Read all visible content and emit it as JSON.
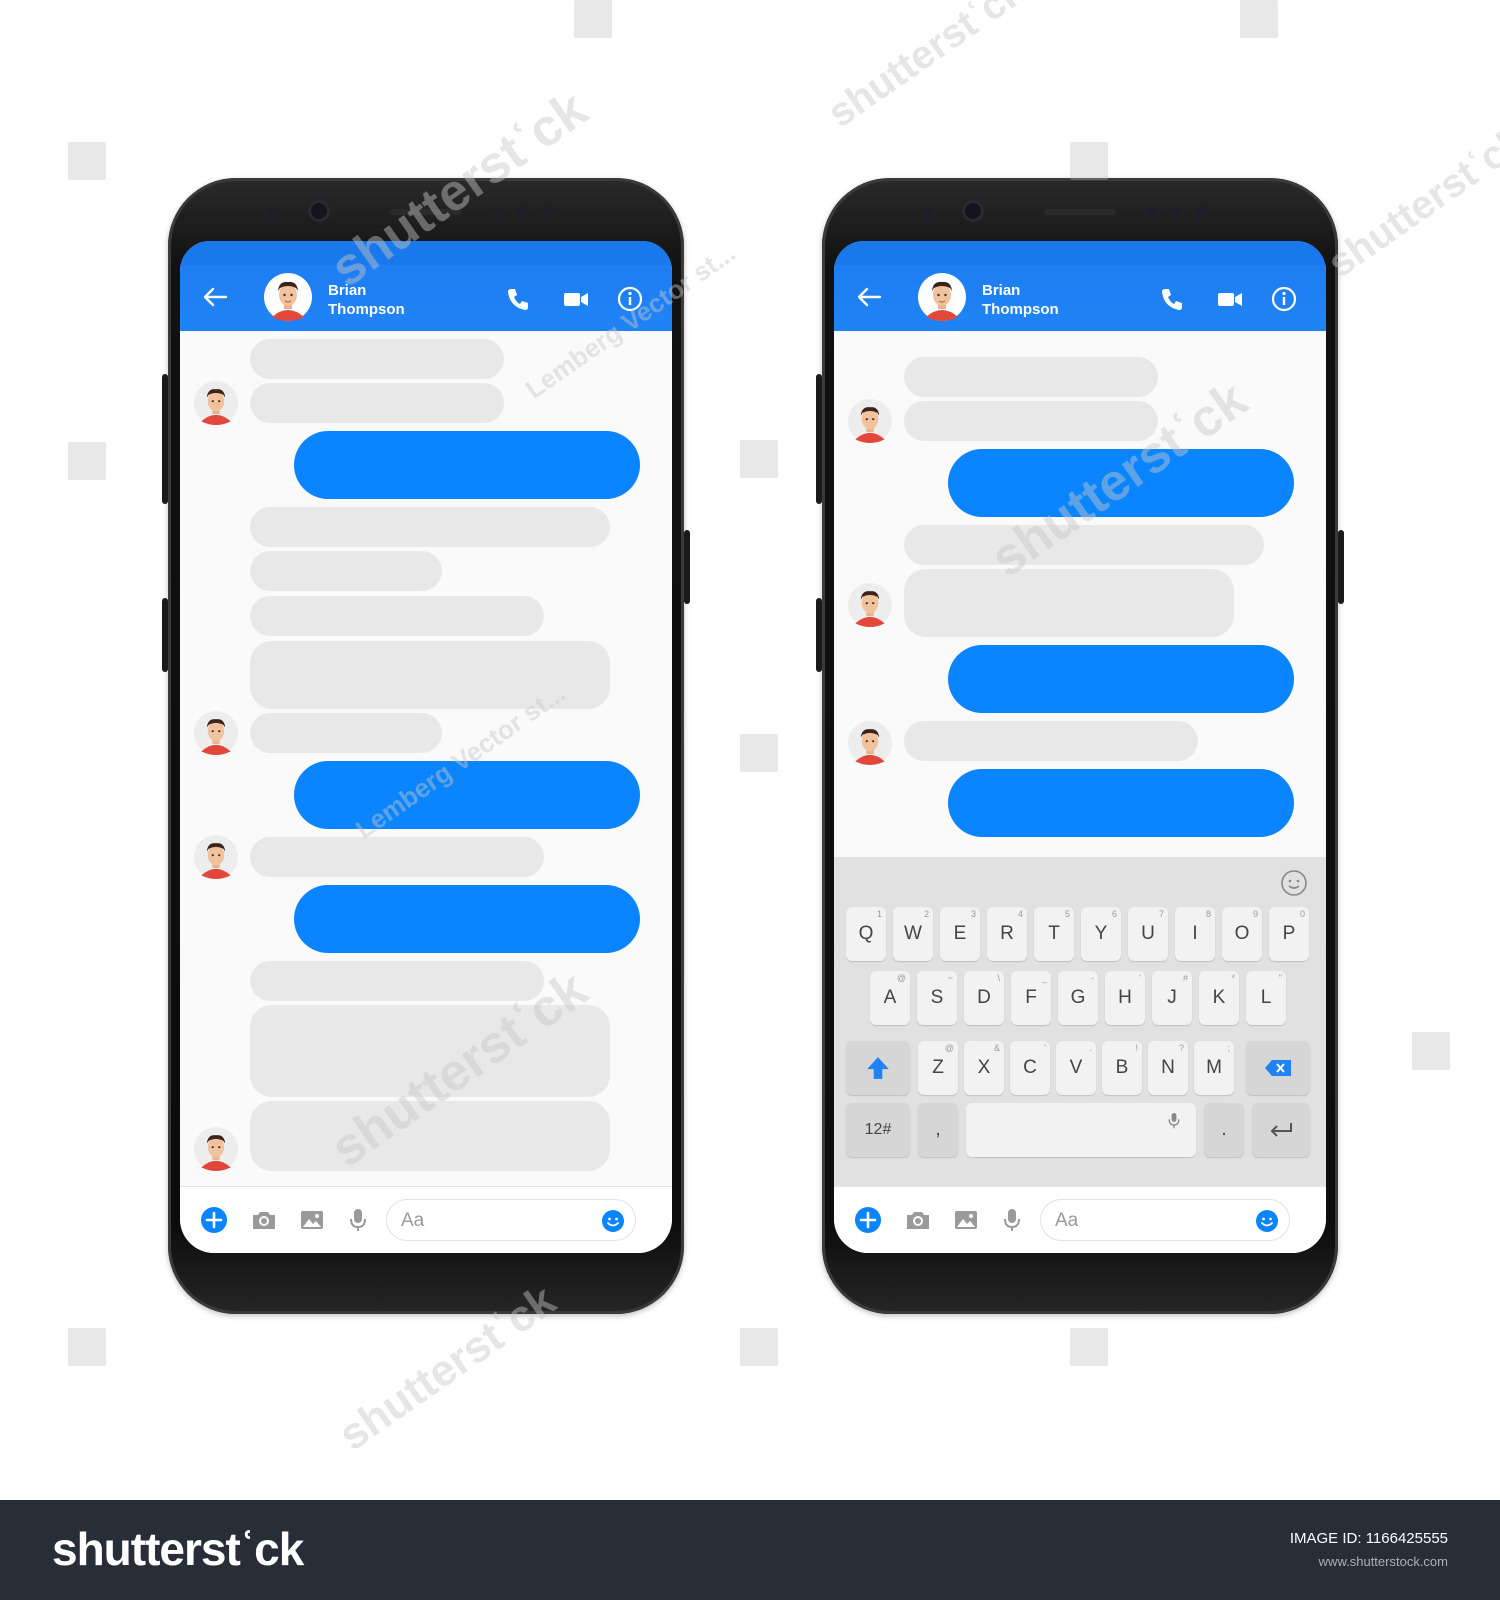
{
  "contact": {
    "name": "Brian\nThompson"
  },
  "composer": {
    "placeholder": "Aa"
  },
  "keyboard": {
    "row1": [
      {
        "k": "Q",
        "h": "1"
      },
      {
        "k": "W",
        "h": "2"
      },
      {
        "k": "E",
        "h": "3"
      },
      {
        "k": "R",
        "h": "4"
      },
      {
        "k": "T",
        "h": "5"
      },
      {
        "k": "Y",
        "h": "6"
      },
      {
        "k": "U",
        "h": "7"
      },
      {
        "k": "I",
        "h": "8"
      },
      {
        "k": "O",
        "h": "9"
      },
      {
        "k": "P",
        "h": "0"
      }
    ],
    "row2": [
      {
        "k": "A",
        "h": "@"
      },
      {
        "k": "S",
        "h": "~"
      },
      {
        "k": "D",
        "h": "\\"
      },
      {
        "k": "F",
        "h": "_"
      },
      {
        "k": "G",
        "h": "-"
      },
      {
        "k": "H",
        "h": "'"
      },
      {
        "k": "J",
        "h": "#"
      },
      {
        "k": "K",
        "h": "*"
      },
      {
        "k": "L",
        "h": "\""
      }
    ],
    "row3": [
      {
        "k": "Z",
        "h": "@"
      },
      {
        "k": "X",
        "h": "&"
      },
      {
        "k": "C",
        "h": "'"
      },
      {
        "k": "V",
        "h": "."
      },
      {
        "k": "B",
        "h": "!"
      },
      {
        "k": "N",
        "h": "?"
      },
      {
        "k": "M",
        "h": ";"
      }
    ],
    "symbols_label": "12#",
    "comma": ",",
    "period": "."
  },
  "colors": {
    "header": "#1f83f6",
    "outgoing_bubble": "#0a84ff",
    "incoming_bubble": "#e8e8e8",
    "bottom_bar": "#282e38"
  },
  "icons": {
    "header": [
      "back-arrow-icon",
      "phone-icon",
      "video-camera-icon",
      "info-icon"
    ],
    "composer": [
      "plus-icon",
      "camera-icon",
      "image-icon",
      "microphone-icon",
      "emoji-icon"
    ],
    "keyboard": [
      "shift-arrow-icon",
      "backspace-icon",
      "enter-icon",
      "microphone-icon",
      "emoji-icon"
    ]
  },
  "watermark": {
    "brand": "shutterstʿck",
    "image_id_label": "IMAGE ID:",
    "image_id": "1166425555",
    "url": "www.shutterstock.com",
    "contributor": "Lemberg Vector st..."
  }
}
